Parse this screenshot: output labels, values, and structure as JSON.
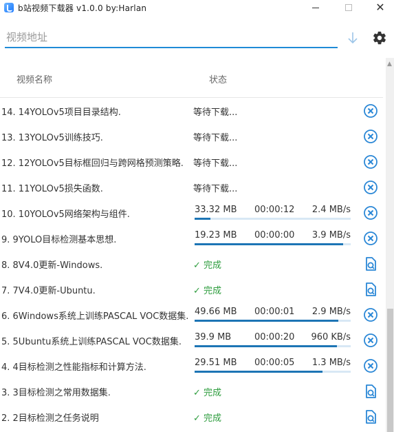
{
  "window": {
    "title": "b站视频下载器 v1.0.0 by:Harlan"
  },
  "toolbar": {
    "url_placeholder": "视频地址",
    "url_value": ""
  },
  "table": {
    "col_name": "视频名称",
    "col_status": "状态"
  },
  "colors": {
    "accent": "#1f8bd6",
    "progress": "#1d75b5",
    "done": "#2e9d3e",
    "icon": "#2a87d6"
  },
  "rows": [
    {
      "name": "14. 14YOLOv5项目目录结构.",
      "state": "waiting",
      "status": "等待下载..."
    },
    {
      "name": "13. 13YOLOv5训练技巧.",
      "state": "waiting",
      "status": "等待下载..."
    },
    {
      "name": "12. 12YOLOv5目标框回归与跨网格预测策略.",
      "state": "waiting",
      "status": "等待下载..."
    },
    {
      "name": "11. 11YOLOv5损失函数.",
      "state": "waiting",
      "status": "等待下载..."
    },
    {
      "name": "10. 10YOLOv5网络架构与组件.",
      "state": "downloading",
      "size": "33.32 MB",
      "time": "00:00:12",
      "speed": "2.4 MB/s",
      "progress": 0.1
    },
    {
      "name": "9. 9YOLO目标检测基本思想.",
      "state": "downloading",
      "size": "19.23 MB",
      "time": "00:00:00",
      "speed": "3.9 MB/s",
      "progress": 0.95
    },
    {
      "name": "8. 8V4.0更新-Windows.",
      "state": "done",
      "status": "完成"
    },
    {
      "name": "7. 7V4.0更新-Ubuntu.",
      "state": "done",
      "status": "完成"
    },
    {
      "name": "6. 6Windows系统上训练PASCAL VOC数据集.",
      "state": "downloading",
      "size": "49.66 MB",
      "time": "00:00:01",
      "speed": "2.9 MB/s",
      "progress": 0.92
    },
    {
      "name": "5. 5Ubuntu系统上训练PASCAL VOC数据集.",
      "state": "downloading",
      "size": "39.9 MB",
      "time": "00:00:20",
      "speed": "960 KB/s",
      "progress": 0.91
    },
    {
      "name": "4. 4目标检测之性能指标和计算方法.",
      "state": "downloading",
      "size": "29.51 MB",
      "time": "00:00:05",
      "speed": "1.3 MB/s",
      "progress": 0.82
    },
    {
      "name": "3. 3目标检测之常用数据集.",
      "state": "done",
      "status": "完成"
    },
    {
      "name": "2. 2目标检测之任务说明",
      "state": "done",
      "status": "完成"
    }
  ]
}
